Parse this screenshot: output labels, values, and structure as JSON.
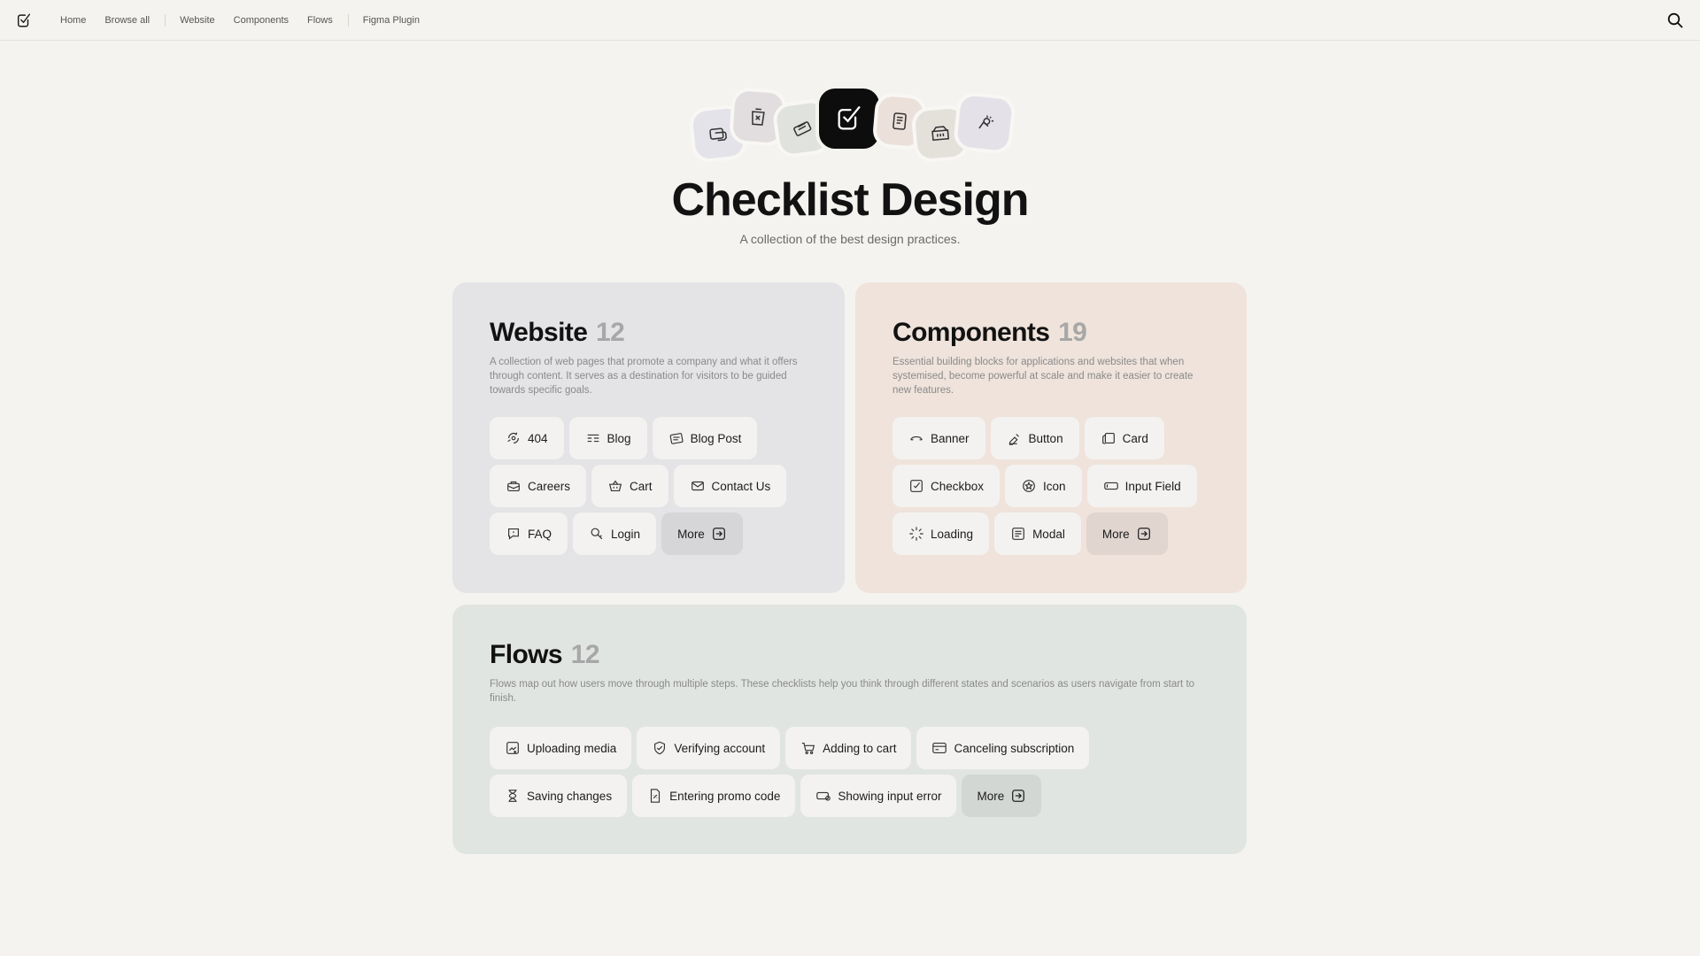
{
  "nav": {
    "items": [
      "Home",
      "Browse all",
      "Website",
      "Components",
      "Flows",
      "Figma Plugin"
    ],
    "icons": {
      "logo": "checkbox-logo-icon",
      "search": "search-icon"
    }
  },
  "hero": {
    "title": "Checklist Design",
    "subtitle": "A collection of the best design practices."
  },
  "sections": {
    "website": {
      "title": "Website",
      "count": "12",
      "description": "A collection of web pages that promote a company and what it offers through content. It serves as a destination for visitors to be guided towards specific goals.",
      "items": [
        {
          "label": "404",
          "icon": "broken-link-icon"
        },
        {
          "label": "Blog",
          "icon": "blog-icon"
        },
        {
          "label": "Blog Post",
          "icon": "blog-post-icon"
        },
        {
          "label": "Careers",
          "icon": "careers-icon"
        },
        {
          "label": "Cart",
          "icon": "cart-icon"
        },
        {
          "label": "Contact Us",
          "icon": "mail-icon"
        },
        {
          "label": "FAQ",
          "icon": "faq-icon"
        },
        {
          "label": "Login",
          "icon": "login-icon"
        }
      ],
      "more": "More"
    },
    "components": {
      "title": "Components",
      "count": "19",
      "description": "Essential building blocks for applications and websites that when systemised, become powerful at scale and make it easier to create new features.",
      "items": [
        {
          "label": "Banner",
          "icon": "banner-icon"
        },
        {
          "label": "Button",
          "icon": "button-icon"
        },
        {
          "label": "Card",
          "icon": "card-icon"
        },
        {
          "label": "Checkbox",
          "icon": "checkbox-icon"
        },
        {
          "label": "Icon",
          "icon": "star-icon"
        },
        {
          "label": "Input Field",
          "icon": "input-field-icon"
        },
        {
          "label": "Loading",
          "icon": "loading-icon"
        },
        {
          "label": "Modal",
          "icon": "modal-icon"
        }
      ],
      "more": "More"
    },
    "flows": {
      "title": "Flows",
      "count": "12",
      "description": "Flows map out how users move through multiple steps. These checklists help you think through different states and scenarios as users navigate from start to finish.",
      "items": [
        {
          "label": "Uploading media",
          "icon": "upload-media-icon"
        },
        {
          "label": "Verifying account",
          "icon": "shield-check-icon"
        },
        {
          "label": "Adding to cart",
          "icon": "add-cart-icon"
        },
        {
          "label": "Canceling subscription",
          "icon": "credit-card-icon"
        },
        {
          "label": "Saving changes",
          "icon": "hourglass-icon"
        },
        {
          "label": "Entering promo code",
          "icon": "promo-code-icon"
        },
        {
          "label": "Showing input error",
          "icon": "input-error-icon"
        }
      ],
      "more": "More"
    }
  },
  "colors": {
    "background": "#f4f3ef",
    "website_card": "#e4e3e6",
    "components_card": "#efe3db",
    "flows_card": "#e1e5e1",
    "chip": "#f3f2f0"
  }
}
